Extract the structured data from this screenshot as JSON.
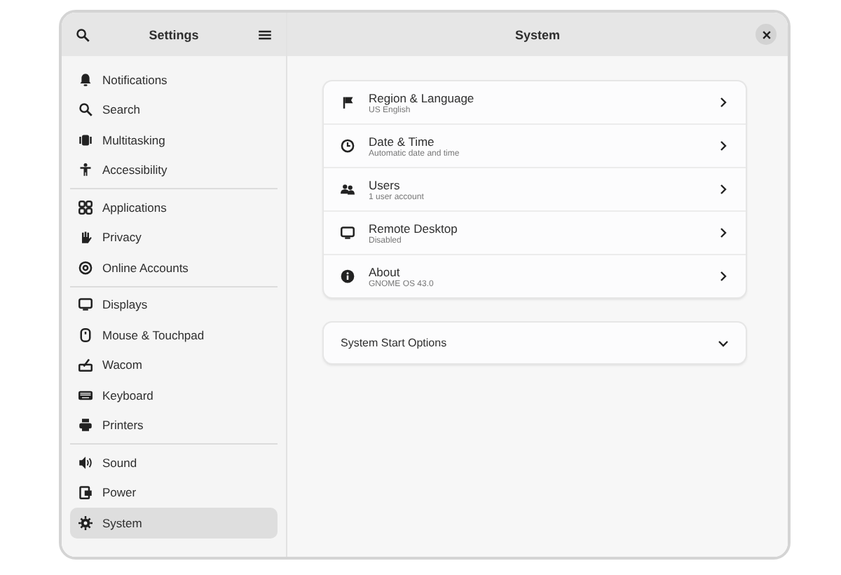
{
  "sidebar": {
    "title": "Settings",
    "groups": [
      {
        "items": [
          {
            "label": "Notifications",
            "selected": false
          },
          {
            "label": "Search",
            "selected": false
          },
          {
            "label": "Multitasking",
            "selected": false
          },
          {
            "label": "Accessibility",
            "selected": false
          }
        ]
      },
      {
        "items": [
          {
            "label": "Applications",
            "selected": false
          },
          {
            "label": "Privacy",
            "selected": false
          },
          {
            "label": "Online Accounts",
            "selected": false
          }
        ]
      },
      {
        "items": [
          {
            "label": "Displays",
            "selected": false
          },
          {
            "label": "Mouse & Touchpad",
            "selected": false
          },
          {
            "label": "Wacom",
            "selected": false
          },
          {
            "label": "Keyboard",
            "selected": false
          },
          {
            "label": "Printers",
            "selected": false
          }
        ]
      },
      {
        "items": [
          {
            "label": "Sound",
            "selected": false
          },
          {
            "label": "Power",
            "selected": false
          },
          {
            "label": "System",
            "selected": true
          }
        ]
      }
    ]
  },
  "main": {
    "title": "System",
    "rows": [
      {
        "title": "Region & Language",
        "subtitle": "US English"
      },
      {
        "title": "Date & Time",
        "subtitle": "Automatic date and time"
      },
      {
        "title": "Users",
        "subtitle": "1 user account"
      },
      {
        "title": "Remote Desktop",
        "subtitle": "Disabled"
      },
      {
        "title": "About",
        "subtitle": "GNOME OS 43.0"
      }
    ],
    "expander": {
      "title": "System Start Options",
      "expanded": false
    }
  }
}
